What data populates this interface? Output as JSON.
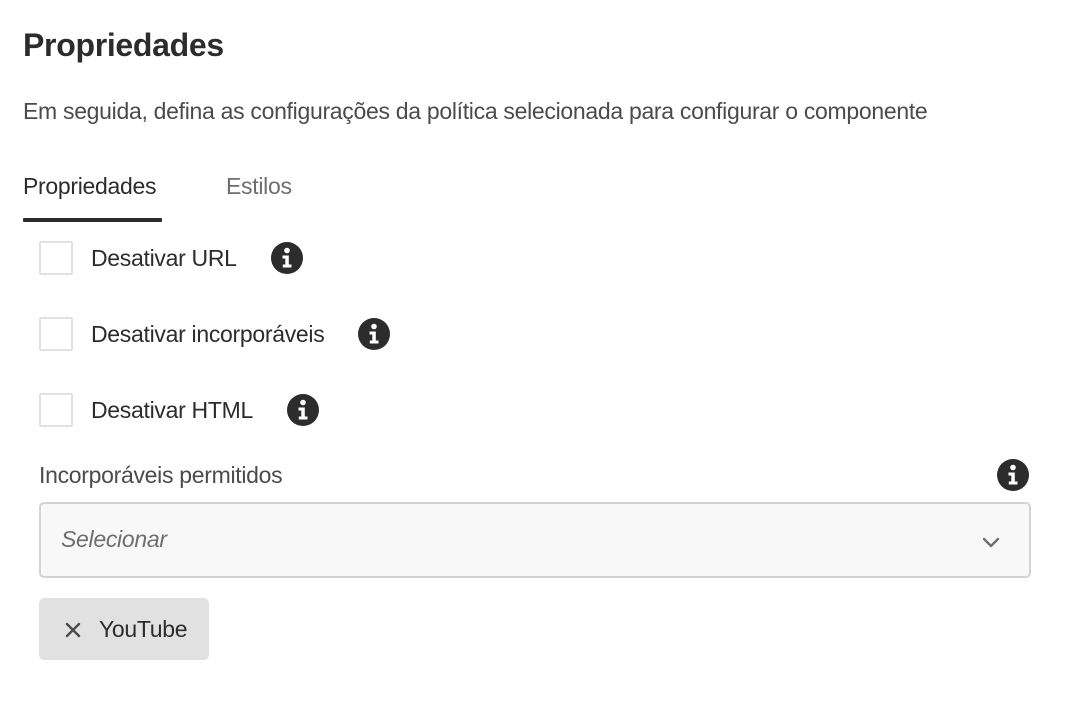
{
  "header": {
    "title": "Propriedades",
    "description": "Em seguida, defina as configurações da política selecionada para configurar o componente"
  },
  "tabs": [
    {
      "label": "Propriedades",
      "active": true
    },
    {
      "label": "Estilos",
      "active": false
    }
  ],
  "checkboxes": [
    {
      "label": "Desativar URL",
      "checked": false
    },
    {
      "label": "Desativar incorporáveis",
      "checked": false
    },
    {
      "label": "Desativar HTML",
      "checked": false
    }
  ],
  "allowed_embeds": {
    "label": "Incorporáveis permitidos",
    "placeholder": "Selecionar",
    "selected_tags": [
      {
        "label": "YouTube"
      }
    ]
  },
  "colors": {
    "text_primary": "#2c2c2c",
    "text_secondary": "#4b4b4b",
    "checkbox_border": "#e1e1e1",
    "select_background": "#f8f8f8",
    "select_border": "#d3d3d3",
    "tag_background": "#e1e1e1"
  },
  "icons": {
    "info": "info-icon",
    "chevron": "chevron-down-icon",
    "remove": "close-icon"
  }
}
